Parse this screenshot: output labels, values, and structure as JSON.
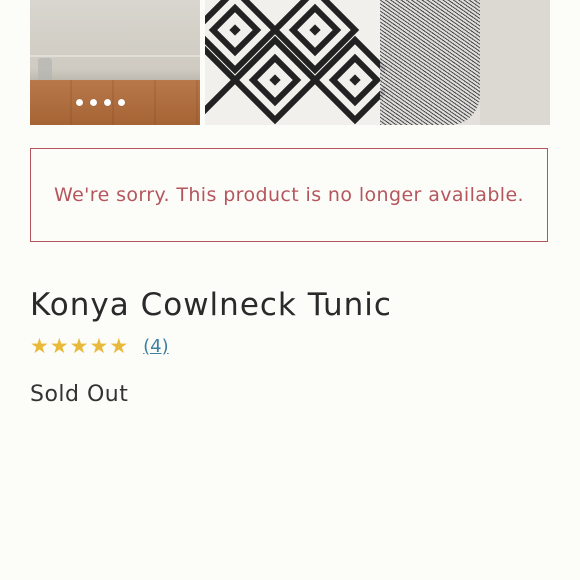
{
  "gallery": {
    "images": [
      {
        "description_icon": "product-photo-room"
      },
      {
        "description_icon": "product-photo-pattern"
      }
    ],
    "dots_count": 4,
    "colors": {
      "pattern_dark": "#222222",
      "pattern_light": "#f2f0ec"
    }
  },
  "notice": {
    "message": "We're sorry. This product is no longer available.",
    "color": "#b5565e"
  },
  "product": {
    "title": "Konya Cowlneck Tunic",
    "rating": {
      "stars": 5,
      "star_glyph": "★",
      "star_color": "#e8b93b",
      "review_count_label": "(4)"
    },
    "availability": "Sold Out"
  }
}
